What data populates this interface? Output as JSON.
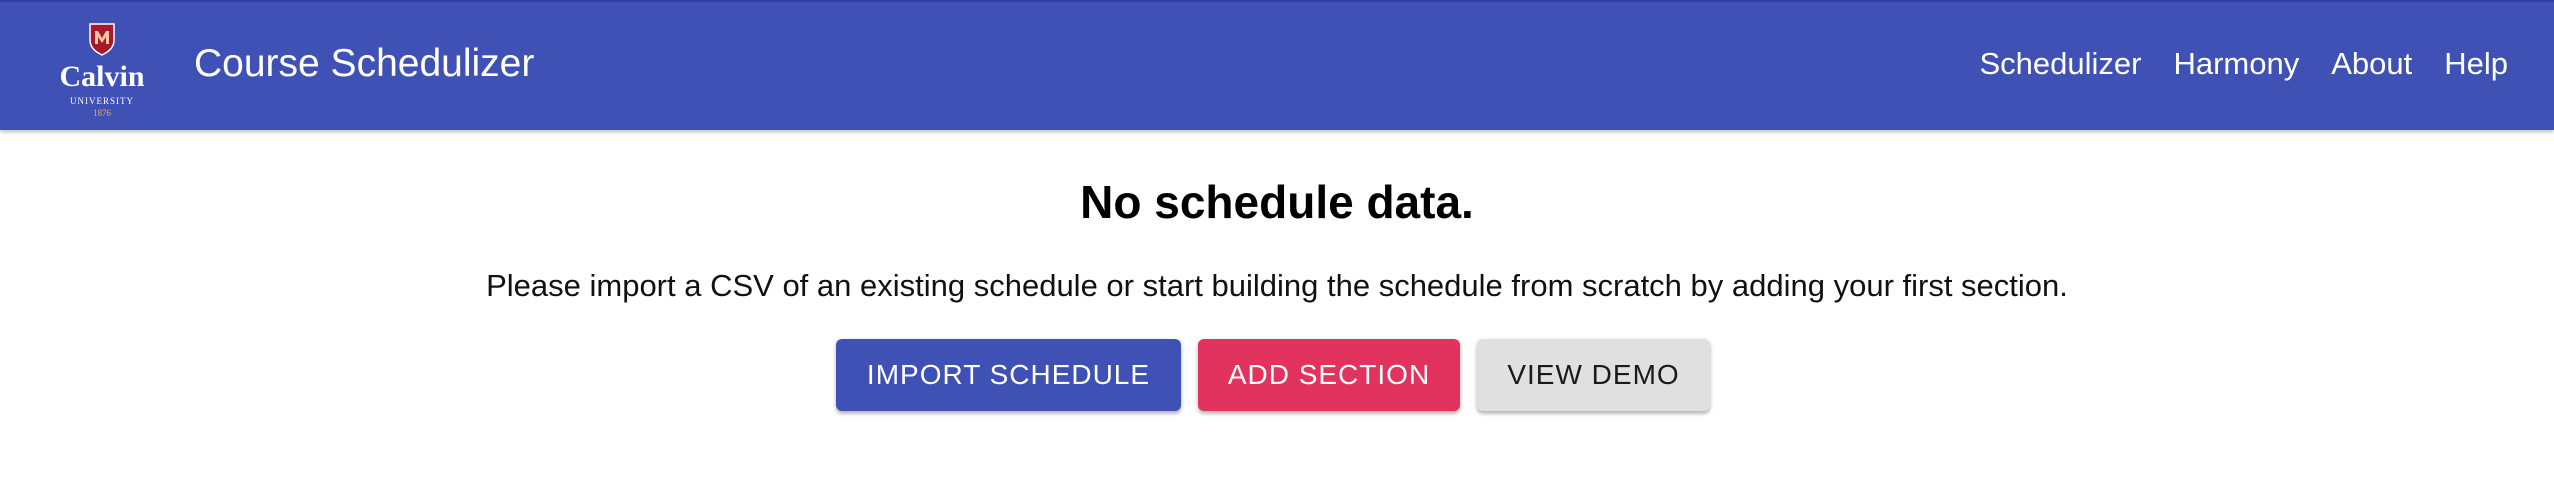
{
  "header": {
    "logo": {
      "wordmark": "Calvin",
      "subtitle": "UNIVERSITY",
      "year": "1876",
      "shield_color": "#a6192e",
      "year_color": "#e0b25c"
    },
    "title": "Course Schedulizer",
    "nav": [
      {
        "label": "Schedulizer"
      },
      {
        "label": "Harmony"
      },
      {
        "label": "About"
      },
      {
        "label": "Help"
      }
    ],
    "bar_color": "#3f51b5"
  },
  "main": {
    "heading": "No schedule data.",
    "description": "Please import a CSV of an existing schedule or start building the schedule from scratch by adding your first section.",
    "buttons": {
      "import": {
        "label": "IMPORT SCHEDULE",
        "color": "#3f51b5"
      },
      "add": {
        "label": "ADD SECTION",
        "color": "#e2335f"
      },
      "demo": {
        "label": "VIEW DEMO",
        "color": "#e0e0e0"
      }
    }
  }
}
